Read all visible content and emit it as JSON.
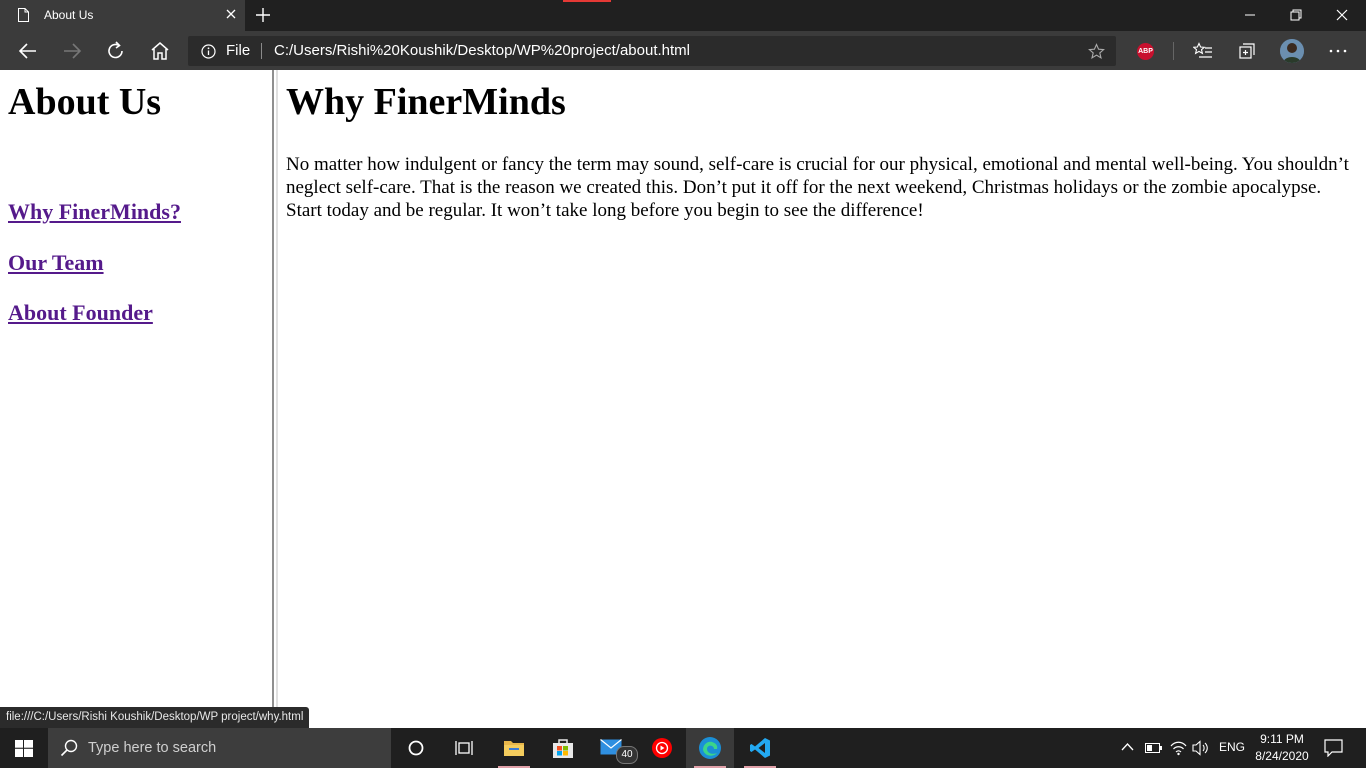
{
  "browser": {
    "tab_title": "About Us",
    "omnibox": {
      "scheme_label": "File",
      "url": "C:/Users/Rishi%20Koushik/Desktop/WP%20project/about.html"
    },
    "extension_abp_label": "ABP",
    "status_url": "file:///C:/Users/Rishi Koushik/Desktop/WP project/why.html"
  },
  "left_frame": {
    "heading": "About Us",
    "links": [
      "Why FinerMinds?",
      "Our Team",
      "About Founder"
    ],
    "link_color": "#551a8b"
  },
  "right_frame": {
    "heading": "Why FinerMinds",
    "paragraph": "No matter how indulgent or fancy the term may sound, self-care is crucial for our physical, emotional and mental well-being. You shouldn’t neglect self-care. That is the reason we created this. Don’t put it off for the next weekend, Christmas holidays or the zombie apocalypse. Start today and be regular. It won’t take long before you begin to see the difference!"
  },
  "taskbar": {
    "search_placeholder": "Type here to search",
    "mail_badge": "40",
    "language": "ENG",
    "time": "9:11 PM",
    "date": "8/24/2020"
  }
}
